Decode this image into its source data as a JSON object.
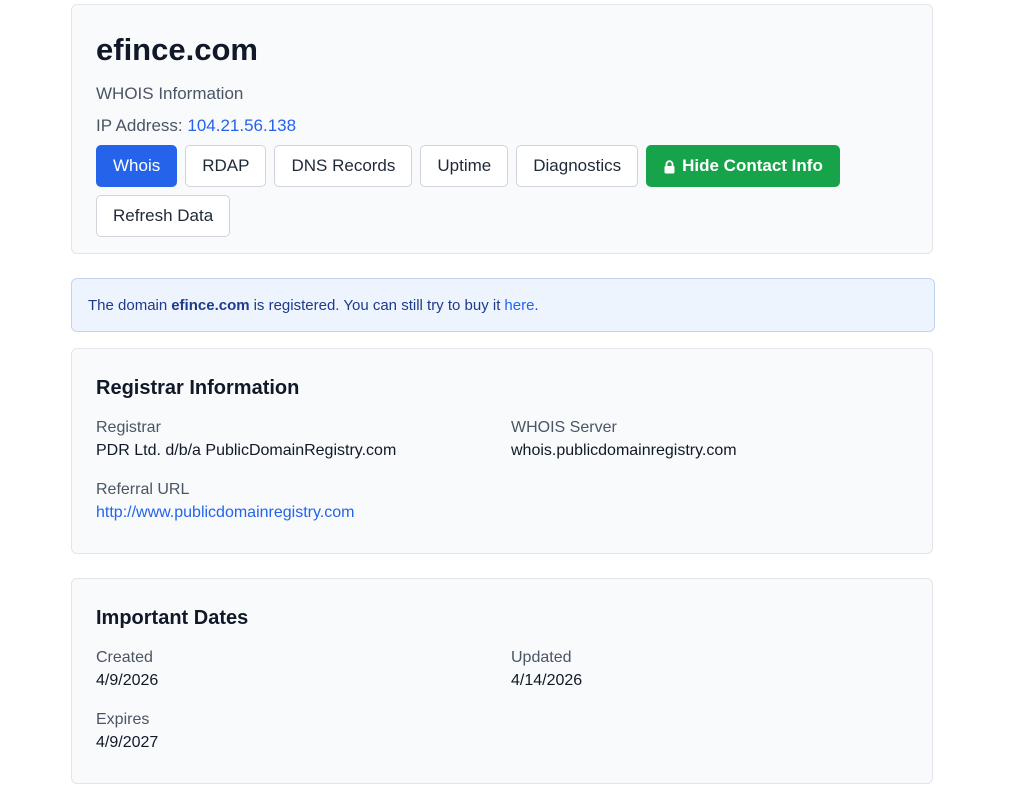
{
  "header": {
    "domain": "efince.com",
    "subtitle": "WHOIS Information",
    "ip_label": "IP Address:",
    "ip_value": "104.21.56.138",
    "tabs": [
      {
        "label": "Whois",
        "active": true
      },
      {
        "label": "RDAP"
      },
      {
        "label": "DNS Records"
      },
      {
        "label": "Uptime"
      },
      {
        "label": "Diagnostics"
      }
    ],
    "hide_contact_label": "Hide Contact Info",
    "refresh_label": "Refresh Data"
  },
  "notice": {
    "prefix": "The domain",
    "domain": "efince.com",
    "middle": "is registered. You can still try to buy it",
    "link_text": "here",
    "suffix": "."
  },
  "registrar": {
    "title": "Registrar Information",
    "registrar_label": "Registrar",
    "registrar_value": "PDR Ltd. d/b/a PublicDomainRegistry.com",
    "whois_server_label": "WHOIS Server",
    "whois_server_value": "whois.publicdomainregistry.com",
    "referral_label": "Referral URL",
    "referral_value": "http://www.publicdomainregistry.com"
  },
  "dates": {
    "title": "Important Dates",
    "created_label": "Created",
    "created_value": "4/9/2026",
    "updated_label": "Updated",
    "updated_value": "4/14/2026",
    "expires_label": "Expires",
    "expires_value": "4/9/2027"
  },
  "icons": {
    "hide_contact": "lock-icon"
  },
  "colors": {
    "primary": "#2563eb",
    "success": "#16a34a",
    "notice_bg": "#eef4fd"
  }
}
